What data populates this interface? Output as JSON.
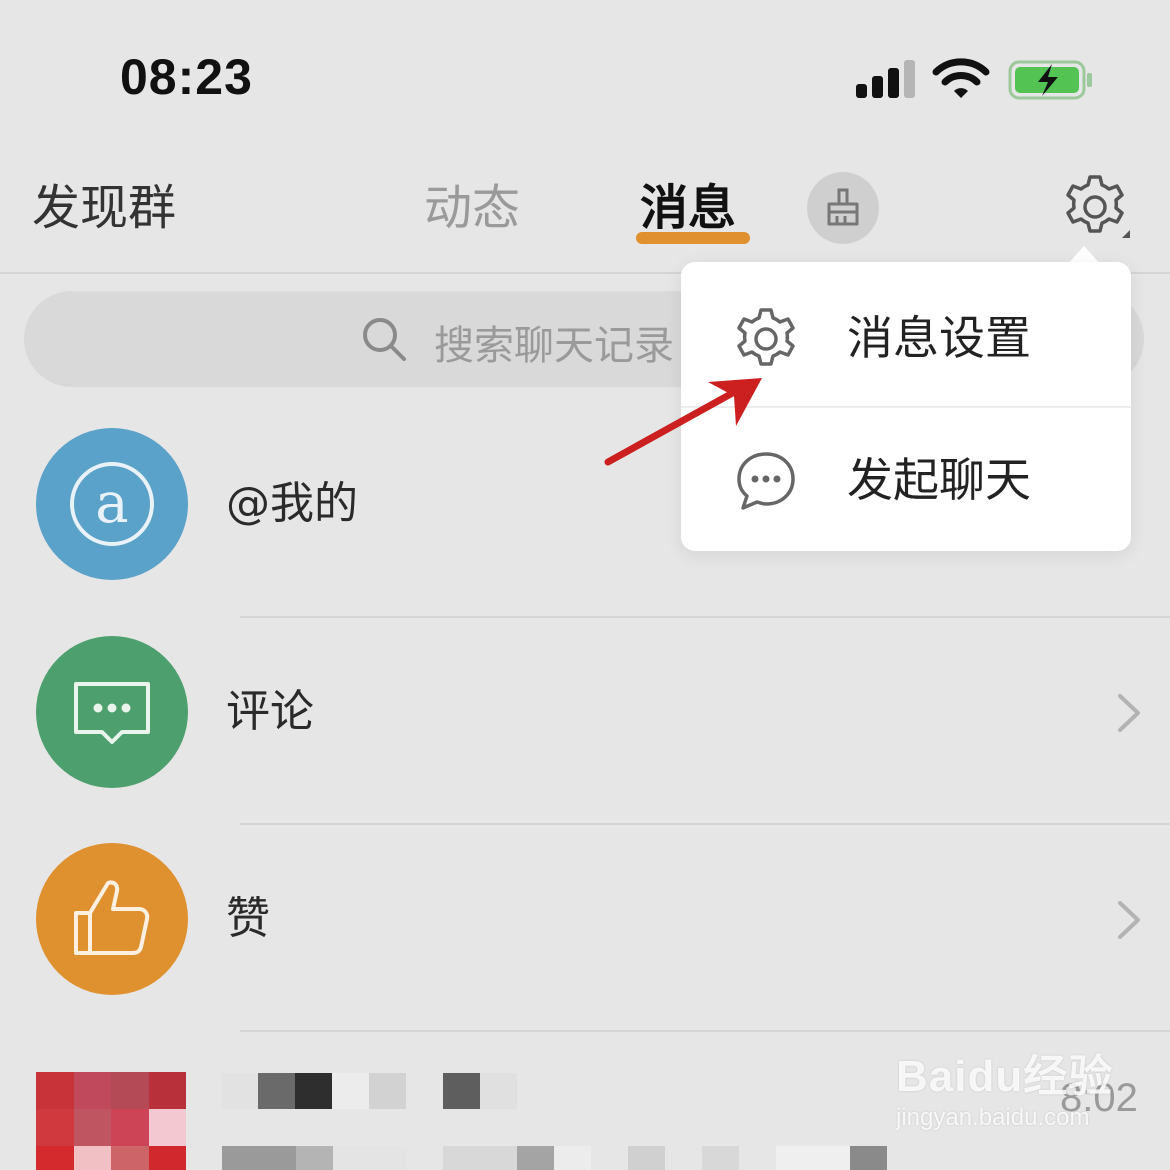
{
  "status_bar": {
    "time": "08:23"
  },
  "nav": {
    "discover": "发现群",
    "dynamic": "动态",
    "message": "消息",
    "active_tab": "消息",
    "accent_color": "#e0902e"
  },
  "search": {
    "placeholder": "搜索聊天记录"
  },
  "list": {
    "items": [
      {
        "label": "@我的",
        "icon": "at-icon",
        "color": "#5aa2c9"
      },
      {
        "label": "评论",
        "icon": "comment-icon",
        "color": "#4d9f6e"
      },
      {
        "label": "赞",
        "icon": "thumbs-up-icon",
        "color": "#e0912f"
      }
    ],
    "partial_row_time": "8:02"
  },
  "popup": {
    "items": [
      {
        "label": "消息设置",
        "icon": "gear-icon"
      },
      {
        "label": "发起聊天",
        "icon": "chat-bubble-icon"
      }
    ]
  },
  "watermark": {
    "brand": "Baidu经验",
    "url": "jingyan.baidu.com"
  }
}
